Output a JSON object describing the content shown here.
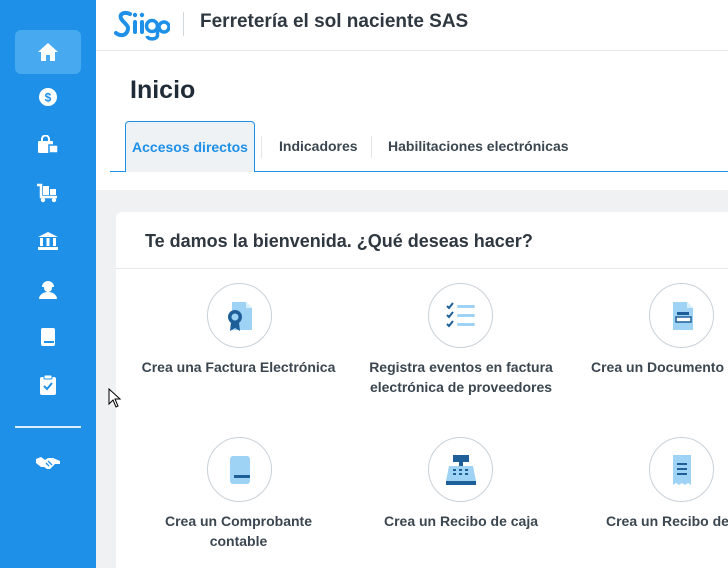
{
  "sidebar": {
    "items": [
      {
        "icon": "home-icon",
        "active": true
      },
      {
        "icon": "dollar-coin-icon"
      },
      {
        "icon": "shopping-bag-icon"
      },
      {
        "icon": "cart-icon"
      },
      {
        "icon": "bank-icon"
      },
      {
        "icon": "user-icon"
      },
      {
        "icon": "book-icon"
      },
      {
        "icon": "clipboard-check-icon"
      },
      {
        "icon": "handshake-icon"
      }
    ]
  },
  "header": {
    "logo_text": "Siigo",
    "company_name": "Ferretería el sol naciente SAS"
  },
  "page": {
    "title": "Inicio"
  },
  "tabs": [
    {
      "label": "Accesos directos",
      "active": true
    },
    {
      "label": "Indicadores"
    },
    {
      "label": "Habilitaciones electrónicas"
    }
  ],
  "welcome": {
    "title": "Te damos la bienvenida. ¿Qué deseas hacer?",
    "actions": [
      {
        "line1": "Crea una Factura Electrónica",
        "line2": "",
        "icon": "invoice-ribbon-icon"
      },
      {
        "line1": "Registra eventos en factura",
        "line2": "electrónica de proveedores",
        "icon": "checklist-icon"
      },
      {
        "line1": "Crea un Documento s",
        "line2": "",
        "icon": "document-icon"
      },
      {
        "line1": "Crea un Comprobante",
        "line2": "contable",
        "icon": "ledger-book-icon"
      },
      {
        "line1": "Crea un Recibo de caja",
        "line2": "",
        "icon": "cash-register-icon"
      },
      {
        "line1": "Crea un Recibo de p",
        "line2": "",
        "icon": "receipt-icon"
      }
    ]
  },
  "colors": {
    "brand_blue": "#1e90e8",
    "sidebar_active": "#47a9f0",
    "content_bg": "#eff1f3",
    "icon_light_blue": "#9fd3f5"
  }
}
